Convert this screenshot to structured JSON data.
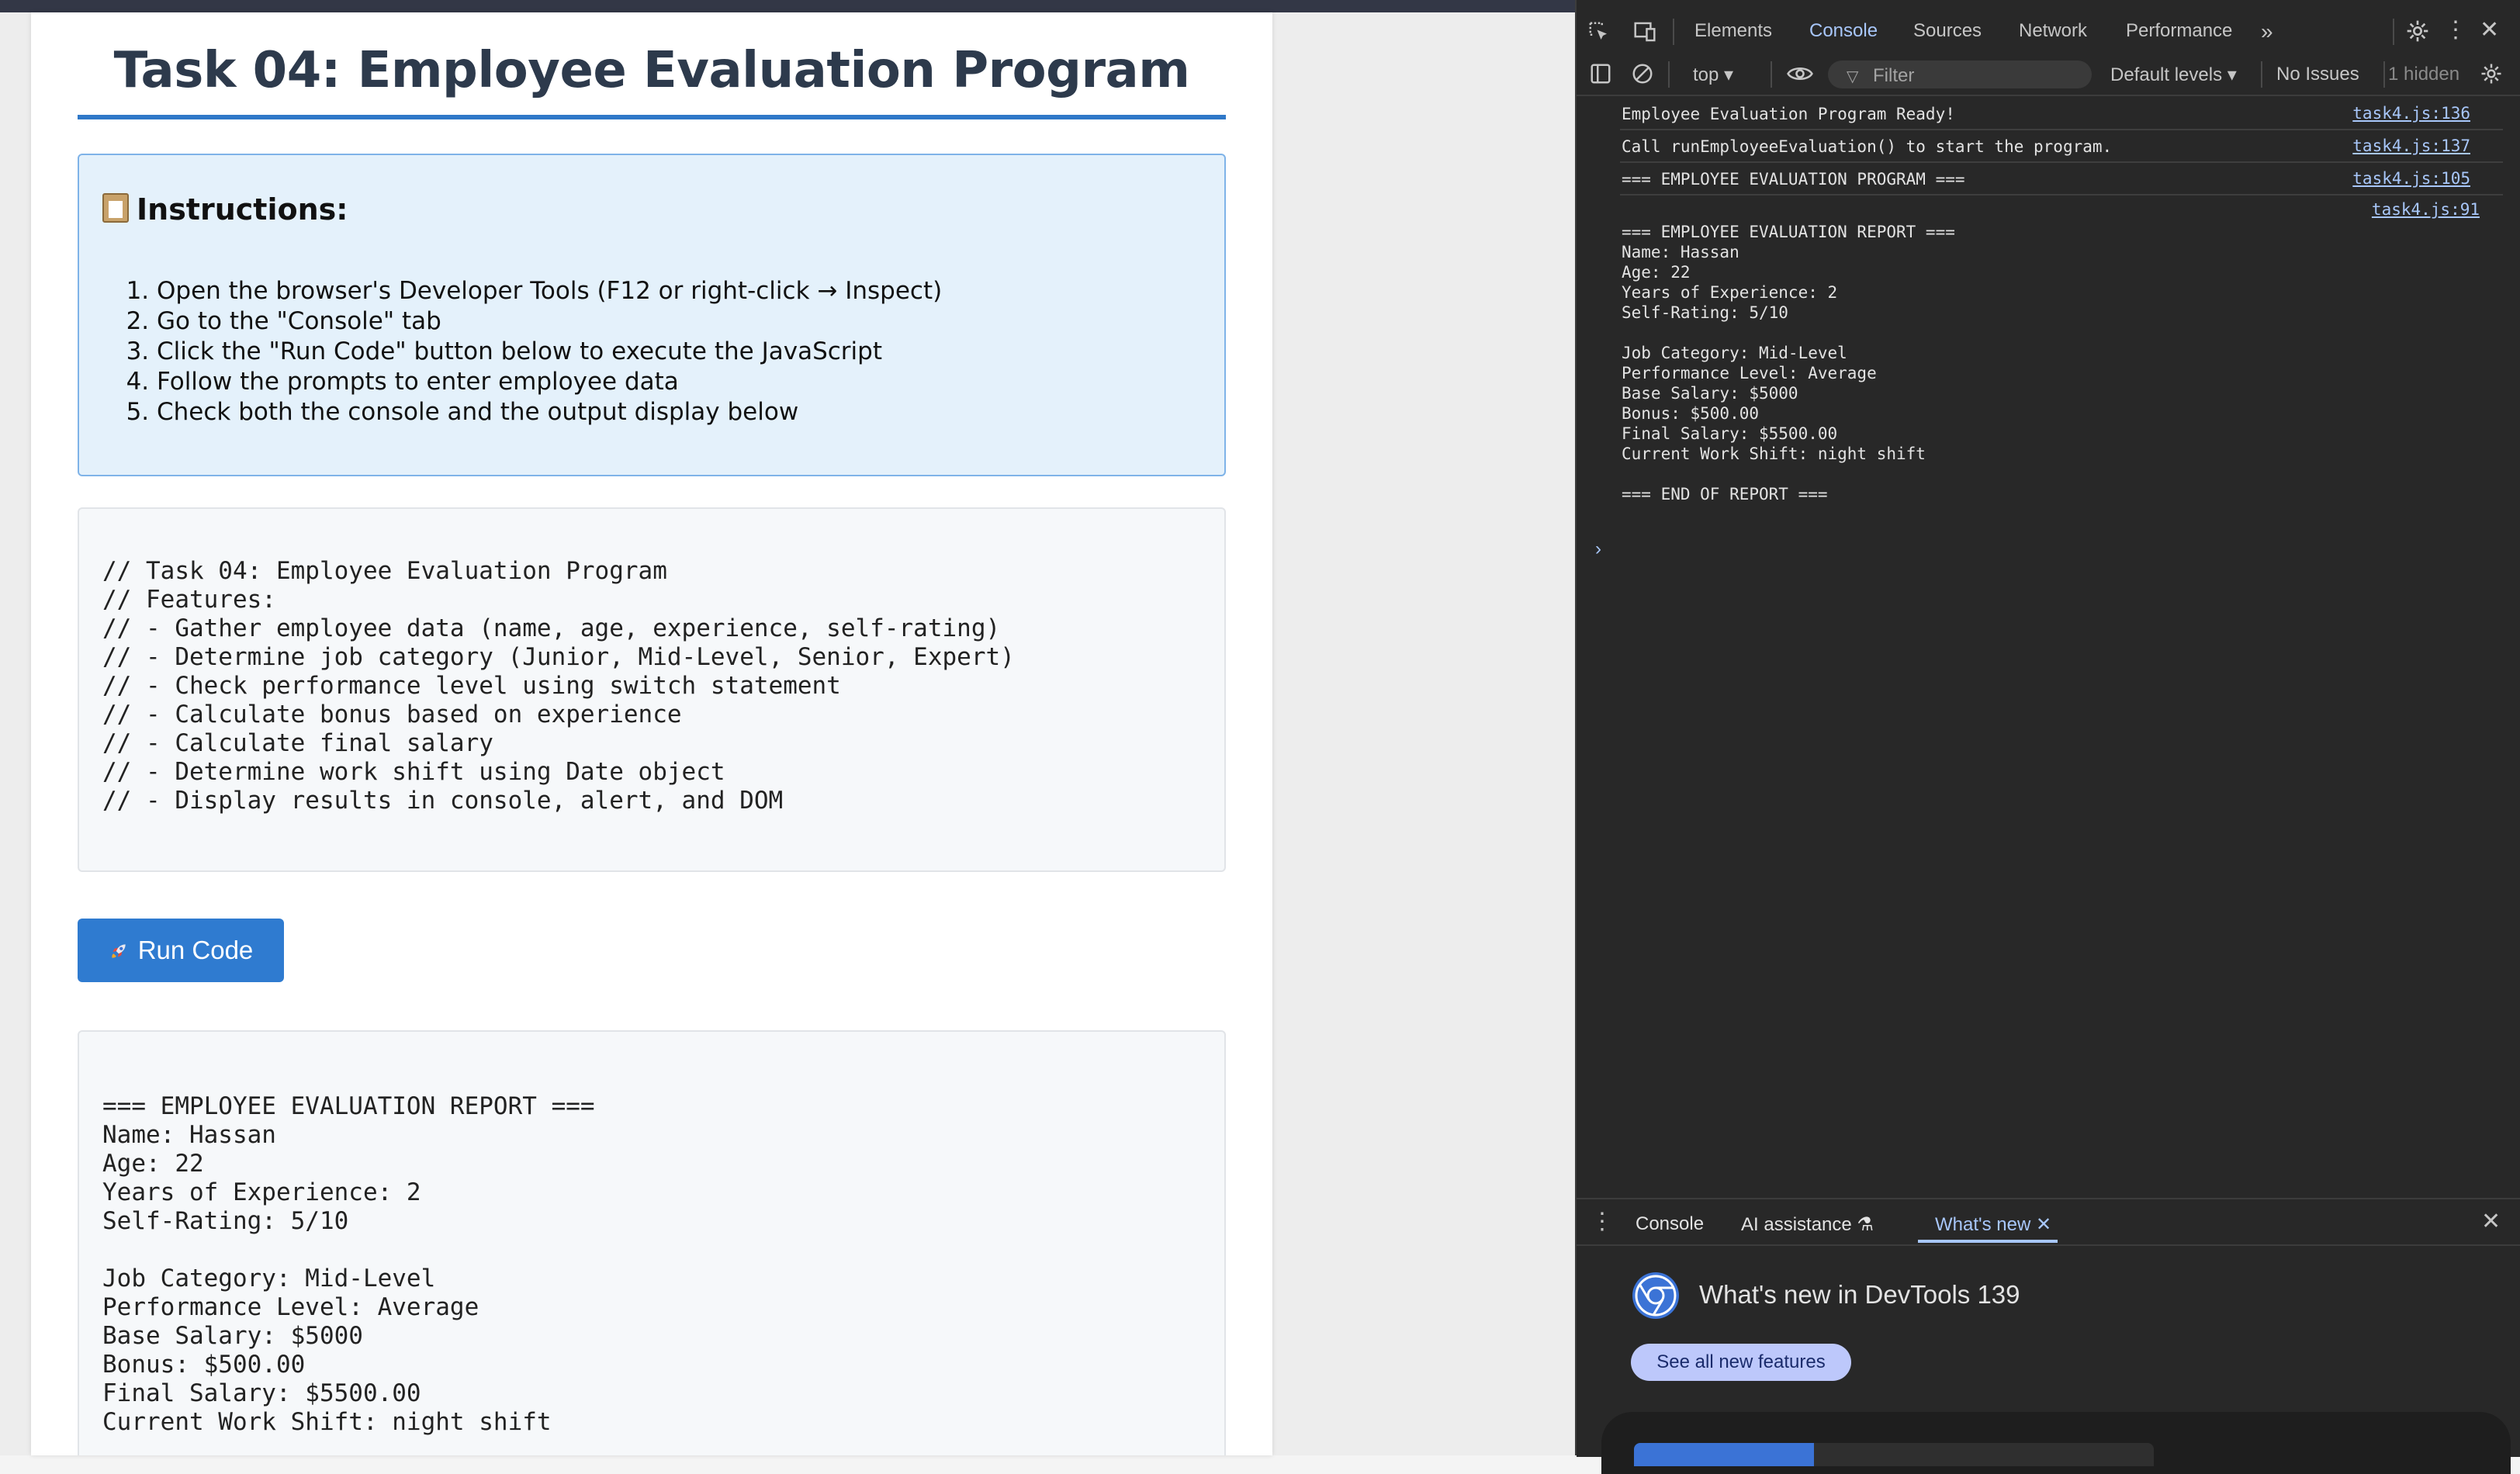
{
  "page": {
    "title": "Task 04: Employee Evaluation Program",
    "instructions_heading": "Instructions:",
    "instructions": [
      "Open the browser's Developer Tools (F12 or right-click → Inspect)",
      "Go to the \"Console\" tab",
      "Click the \"Run Code\" button below to execute the JavaScript",
      "Follow the prompts to enter employee data",
      "Check both the console and the output display below"
    ],
    "code_lines": [
      "// Task 04: Employee Evaluation Program",
      "// Features:",
      "// - Gather employee data (name, age, experience, self-rating)",
      "// - Determine job category (Junior, Mid-Level, Senior, Expert)",
      "// - Check performance level using switch statement",
      "// - Calculate bonus based on experience",
      "// - Calculate final salary",
      "// - Determine work shift using Date object",
      "// - Display results in console, alert, and DOM"
    ],
    "run_button_label": "Run Code",
    "output_lines": [
      "=== EMPLOYEE EVALUATION REPORT ===",
      "Name: Hassan",
      "Age: 22",
      "Years of Experience: 2",
      "Self-Rating: 5/10",
      "",
      "Job Category: Mid-Level",
      "Performance Level: Average",
      "Base Salary: $5000",
      "Bonus: $500.00",
      "Final Salary: $5500.00",
      "Current Work Shift: night shift"
    ]
  },
  "devtools": {
    "tabs": [
      "Elements",
      "Console",
      "Sources",
      "Network",
      "Performance"
    ],
    "active_tab": "Console",
    "toolbar": {
      "context": "top",
      "filter_placeholder": "Filter",
      "levels": "Default levels",
      "issues": "No Issues",
      "hidden": "1 hidden"
    },
    "console_messages": [
      {
        "text": "Employee Evaluation Program Ready!",
        "source": "task4.js:136"
      },
      {
        "text": "Call runEmployeeEvaluation() to start the program.",
        "source": "task4.js:137"
      },
      {
        "text": "=== EMPLOYEE EVALUATION PROGRAM ===",
        "source": "task4.js:105"
      }
    ],
    "report_source": "task4.js:91",
    "report_lines": [
      "",
      "=== EMPLOYEE EVALUATION REPORT ===",
      "Name: Hassan",
      "Age: 22",
      "Years of Experience: 2",
      "Self-Rating: 5/10",
      "",
      "Job Category: Mid-Level",
      "Performance Level: Average",
      "Base Salary: $5000",
      "Bonus: $500.00",
      "Final Salary: $5500.00",
      "Current Work Shift: night shift",
      "",
      "=== END OF REPORT ==="
    ],
    "drawer": {
      "tabs": [
        "Console",
        "AI assistance",
        "What's new"
      ],
      "active_tab": "What's new",
      "headline": "What's new in DevTools 139",
      "button": "See all new features"
    }
  },
  "colors": {
    "accent": "#2f78c8",
    "instructions_bg": "#e4f1fb",
    "devtools_bg": "#282828",
    "devtools_link": "#a8c7fa"
  }
}
